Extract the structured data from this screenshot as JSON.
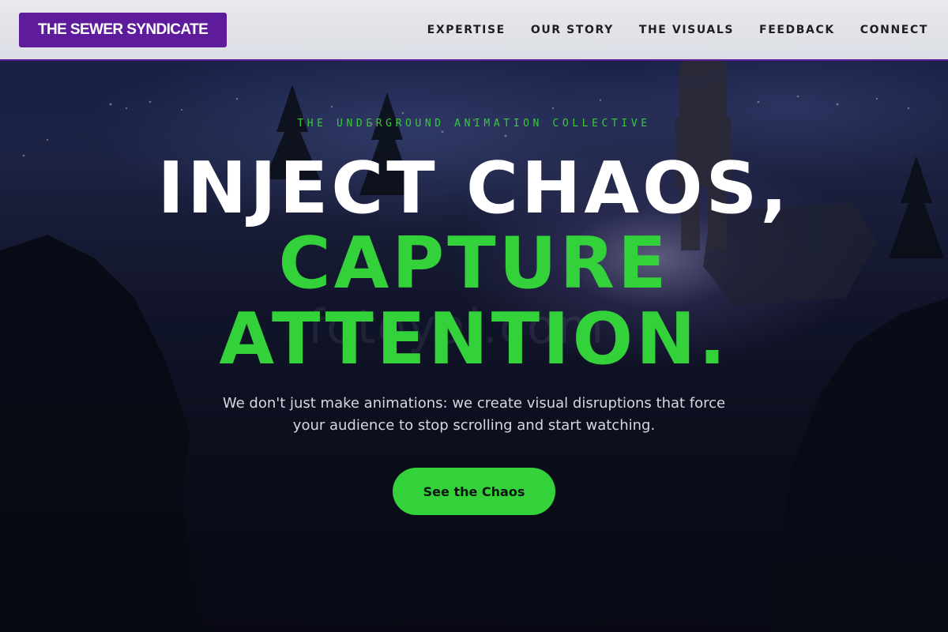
{
  "header": {
    "logo": "THE SEWER SYNDICATE",
    "nav": [
      "EXPERTISE",
      "OUR STORY",
      "THE VISUALS",
      "FEEDBACK",
      "CONNECT"
    ]
  },
  "hero": {
    "tagline": "THE UNDERGROUND ANIMATION COLLECTIVE",
    "headline_line1": "INJECT CHAOS,",
    "headline_line2": "CAPTURE",
    "headline_line3": "ATTENTION.",
    "subtext": "We don't just make animations: we create visual disruptions that force your audience to stop scrolling and start watching.",
    "cta_label": "See the Chaos",
    "watermark": "fotoyal.com"
  },
  "colors": {
    "brand_purple": "#5e1c9c",
    "accent_green": "#33d13a",
    "header_bg": "#dcdee5"
  }
}
